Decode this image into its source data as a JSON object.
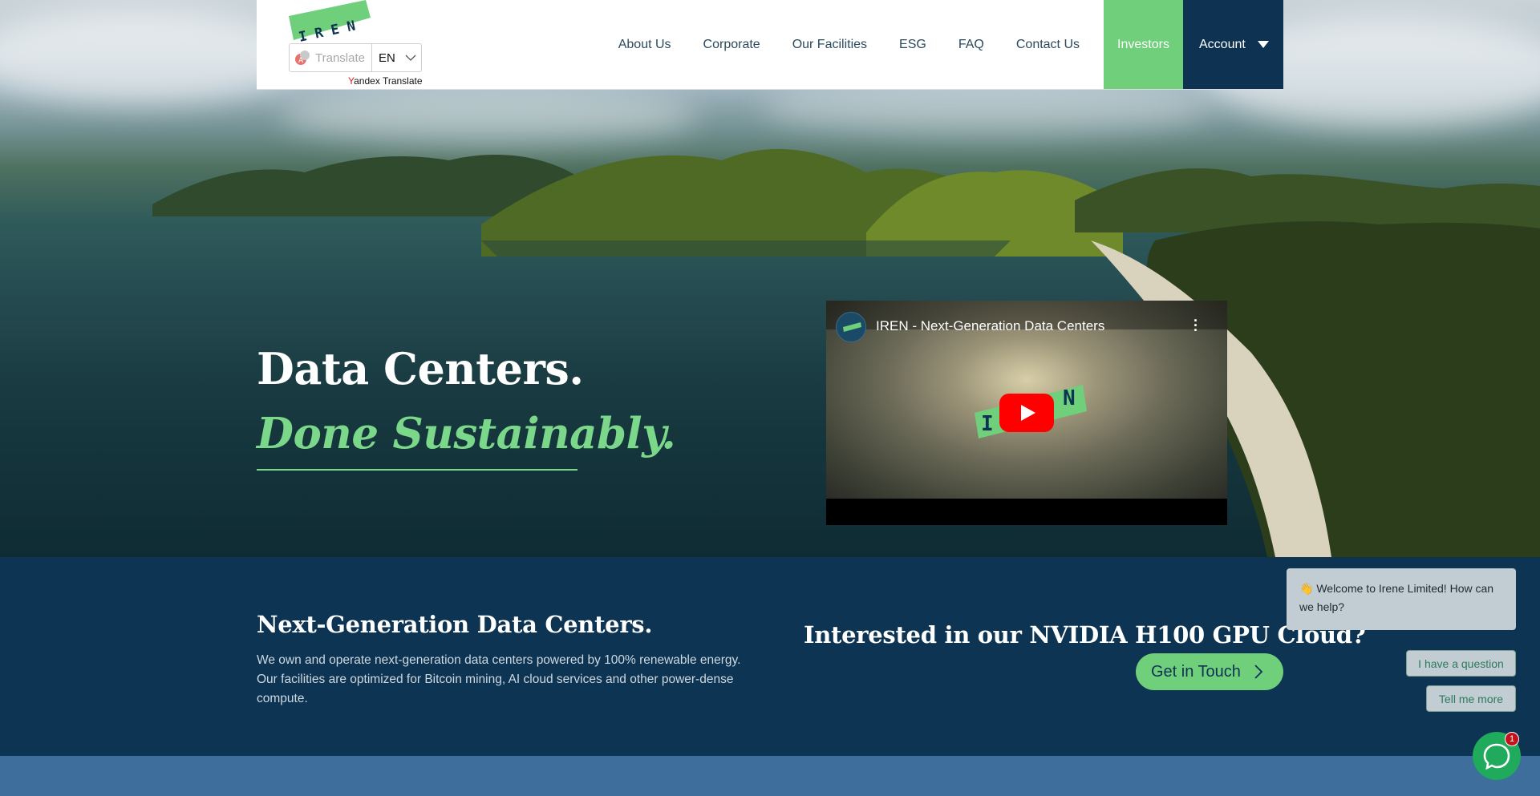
{
  "header": {
    "logo_text": "IREN",
    "translate": {
      "label": "Translate",
      "language": "EN",
      "powered_by_y": "Y",
      "powered_by_rest": "andex Translate"
    },
    "nav": {
      "about": "About Us",
      "corporate": "Corporate",
      "facilities": "Our Facilities",
      "esg": "ESG",
      "faq": "FAQ",
      "contact": "Contact Us",
      "investors": "Investors",
      "account": "Account"
    }
  },
  "hero": {
    "title": "Data Centers.",
    "subtitle": "Done Sustainably.",
    "video": {
      "title": "IREN - Next-Generation Data Centers"
    }
  },
  "about_section": {
    "title": "Next-Generation Data Centers.",
    "description": "We own and operate next-generation data centers powered by 100% renewable energy. Our facilities are optimized for Bitcoin mining, AI cloud services and other power-dense compute."
  },
  "cta": {
    "title": "Interested in our NVIDIA H100 GPU Cloud?",
    "button": "Get in Touch"
  },
  "chat": {
    "welcome": "👋 Welcome to Irene Limited! How can we help?",
    "option_question": "I have a question",
    "option_tell": "Tell me more",
    "badge_count": "1"
  },
  "colors": {
    "brand_green": "#6fcf7b",
    "navy": "#0e3352",
    "accent_green_text": "#7bd88a"
  }
}
